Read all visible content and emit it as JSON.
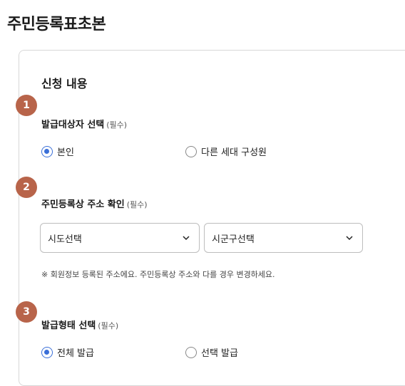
{
  "page_title": "주민등록표초본",
  "section_title": "신청 내용",
  "required_text": "(필수)",
  "accent_color": "#3a6fd8",
  "badge_color": "#b8644a",
  "steps": [
    {
      "number": "1",
      "label": "발급대상자 선택",
      "options": [
        {
          "label": "본인",
          "selected": true
        },
        {
          "label": "다른 세대 구성원",
          "selected": false
        }
      ]
    },
    {
      "number": "2",
      "label": "주민등록상 주소 확인",
      "selects": [
        {
          "value": "시도선택",
          "icon": "chevron-down-icon"
        },
        {
          "value": "시군구선택",
          "icon": "chevron-down-icon"
        }
      ],
      "note": "※ 회원정보 등록된 주소에요. 주민등록상 주소와 다를 경우 변경하세요."
    },
    {
      "number": "3",
      "label": "발급형태 선택",
      "options": [
        {
          "label": "전체 발급",
          "selected": true
        },
        {
          "label": "선택 발급",
          "selected": false
        }
      ]
    }
  ]
}
